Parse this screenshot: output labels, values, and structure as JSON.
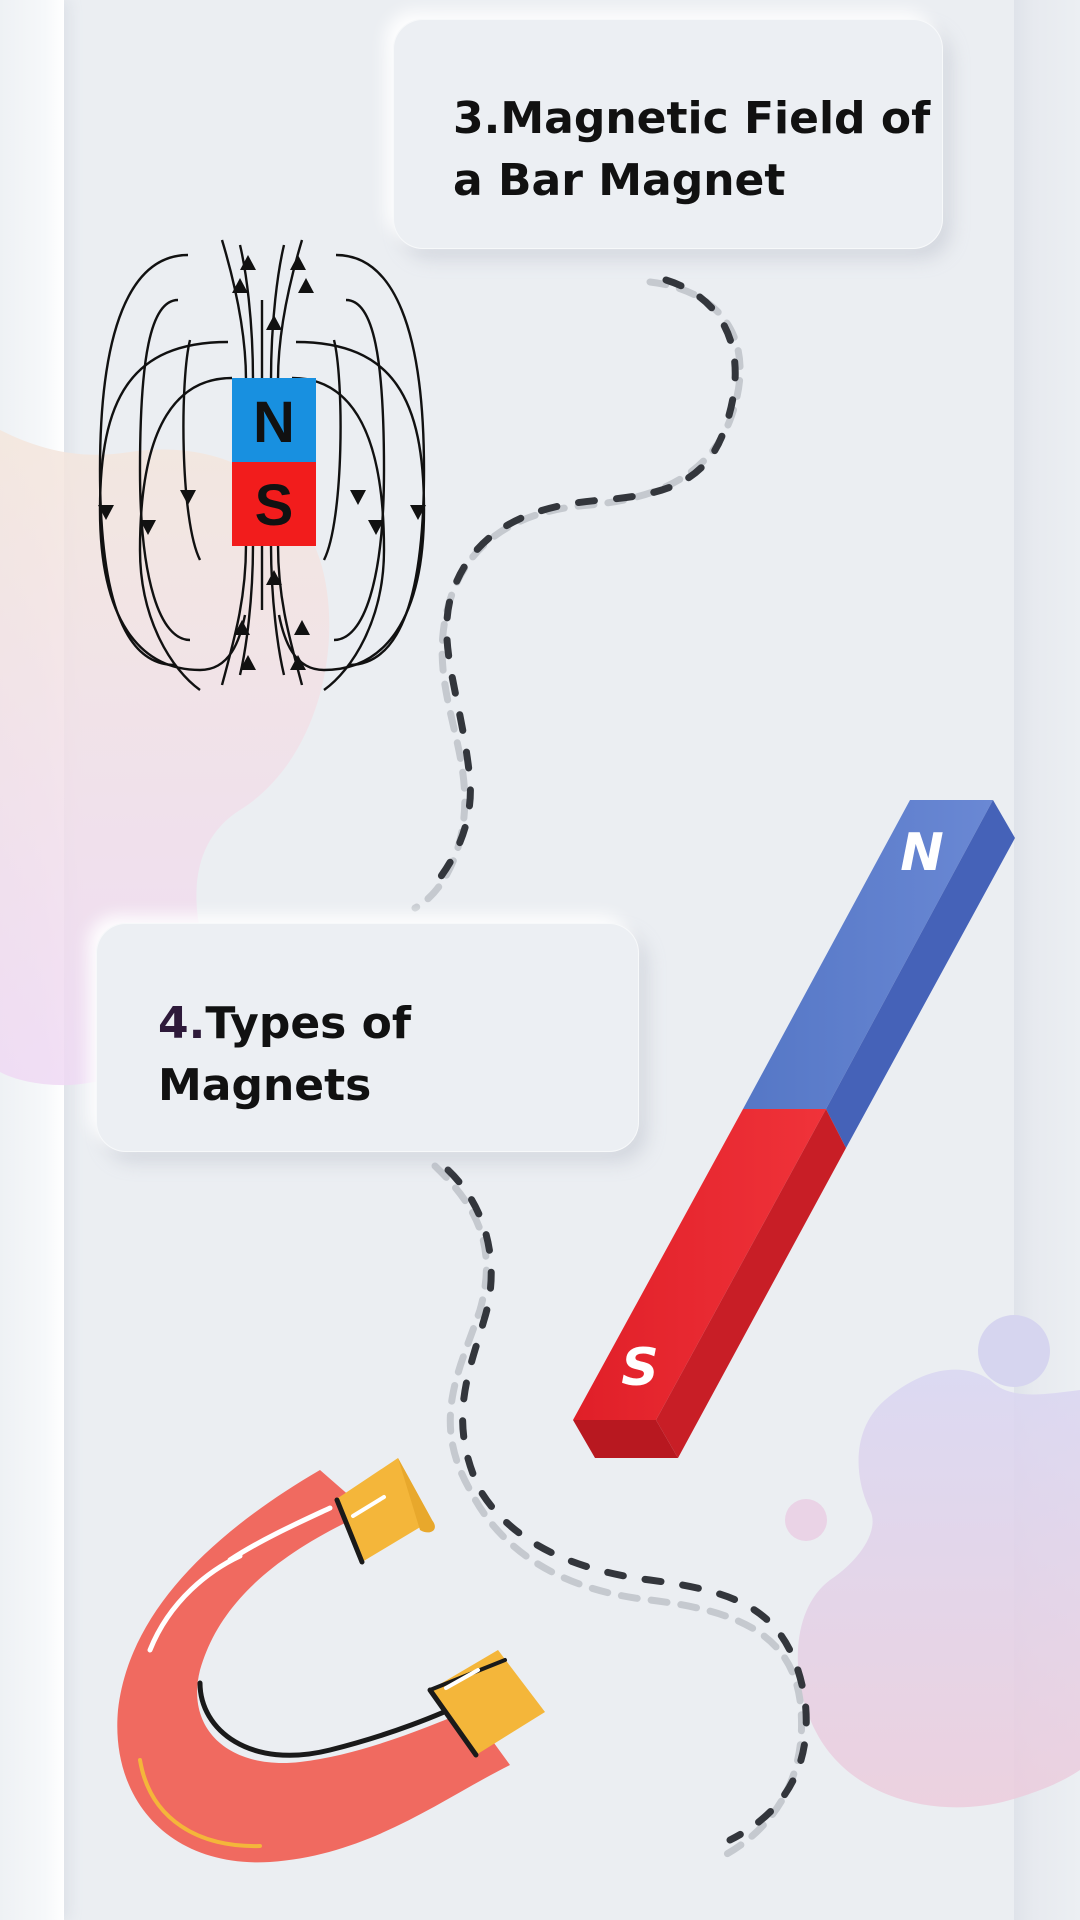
{
  "sections": [
    {
      "number": "3.",
      "title": "Magnetic Field of a Bar Magnet"
    },
    {
      "number": "4.",
      "title": "Types of Magnets"
    }
  ],
  "bar_magnet_diagram": {
    "north_label": "N",
    "south_label": "S"
  },
  "bar_magnet_3d": {
    "north_label": "N",
    "south_label": "S"
  },
  "colors": {
    "background": "#ebeef2",
    "north_blue": "#1890e0",
    "south_red": "#f21c1c",
    "bar_blue": "#5873c8",
    "bar_red": "#e0242c",
    "horseshoe_body": "#f06a60",
    "horseshoe_tip": "#f4b63a"
  },
  "icons": [
    "magnetic-field-diagram",
    "bar-magnet-icon",
    "horseshoe-magnet-icon",
    "dashed-path"
  ]
}
